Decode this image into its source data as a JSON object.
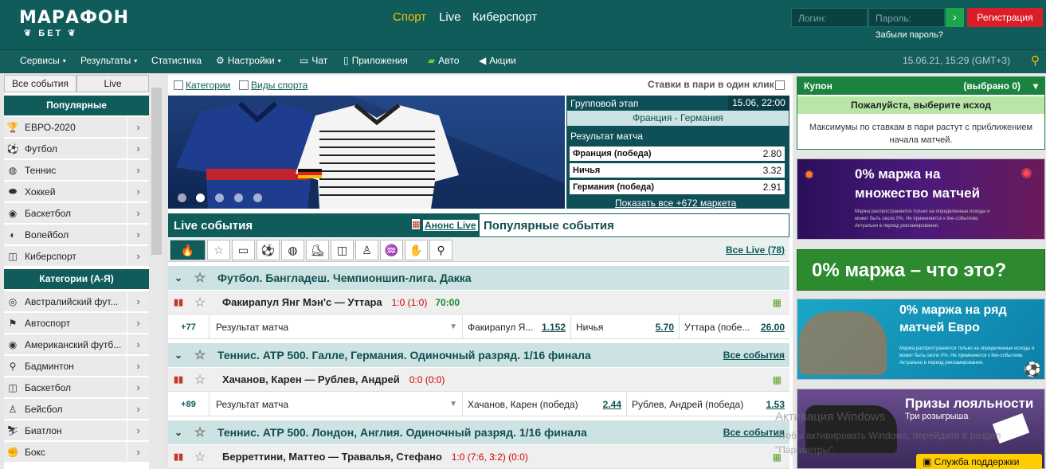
{
  "header": {
    "logo_main": "МАРАФОН",
    "logo_sub": "БЕТ",
    "nav": [
      "Спорт",
      "Live",
      "Киберспорт"
    ],
    "login_placeholder": "Логин:",
    "password_placeholder": "Пароль:",
    "register_label": "Регистрация",
    "forgot_label": "Забыли пароль?",
    "accent_color": "#f5c000"
  },
  "subnav": {
    "items": [
      "Сервисы",
      "Результаты",
      "Статистика",
      "Настройки",
      "Чат",
      "Приложения",
      "Авто",
      "Акции"
    ],
    "datetime": "15.06.21, 15:29 (GMT+3)"
  },
  "sidebar": {
    "tabs": [
      "Все события",
      "Live"
    ],
    "popular_title": "Популярные",
    "popular": [
      "ЕВРО-2020",
      "Футбол",
      "Теннис",
      "Хоккей",
      "Баскетбол",
      "Волейбол",
      "Киберспорт"
    ],
    "categories_title": "Категории (А-Я)",
    "categories": [
      "Австралийский фут...",
      "Автоспорт",
      "Американский футб...",
      "Бадминтон",
      "Баскетбол",
      "Бейсбол",
      "Биатлон",
      "Бокс"
    ]
  },
  "main": {
    "filter_categories": "Категории",
    "filter_sports": "Виды спорта",
    "one_click": "Ставки в пари в один клик",
    "banner": {
      "stage": "Групповой этап",
      "datetime": "15.06, 22:00",
      "match": "Франция - Германия",
      "market": "Результат матча",
      "odds": [
        {
          "label": "Франция (победа)",
          "value": "2.80"
        },
        {
          "label": "Ничья",
          "value": "3.32"
        },
        {
          "label": "Германия (победа)",
          "value": "2.91"
        }
      ],
      "more": "Показать все +672 маркета",
      "active_slide": 2
    },
    "tabs": {
      "live": "Live события",
      "announce": "Анонс Live",
      "popular": "Популярные события"
    },
    "all_live": "Все Live (78)",
    "leagues": [
      {
        "name": "Футбол. Бангладеш. Чемпионшип-лига. Дакка",
        "all": "",
        "event": {
          "teams": "Факирапул Янг Мэн'с — Уттара",
          "score": "1:0 (1:0)",
          "time": "70:00"
        },
        "market": {
          "count": "+77",
          "type": "Результат матча",
          "odds": [
            [
              "Факирапул Я...",
              "1.152"
            ],
            [
              "Ничья",
              "5.70"
            ],
            [
              "Уттара (побе...",
              "26.00"
            ]
          ]
        }
      },
      {
        "name": "Теннис. ATP 500. Галле, Германия. Одиночный разряд. 1/16 финала",
        "all": "Все события",
        "event": {
          "teams": "Хачанов, Карен — Рублев, Андрей",
          "score": "0:0 (0:0)",
          "time": ""
        },
        "market": {
          "count": "+89",
          "type": "Результат матча",
          "odds": [
            [
              "Хачанов, Карен (победа)",
              "2.44"
            ],
            [
              "Рублев, Андрей (победа)",
              "1.53"
            ]
          ]
        }
      },
      {
        "name": "Теннис. ATP 500. Лондон, Англия. Одиночный разряд. 1/16 финала",
        "all": "Все события",
        "event": {
          "teams": "Берреттини, Маттео — Травалья, Стефано",
          "score": "1:0 (7:6, 3:2) (0:0)",
          "time": ""
        }
      }
    ]
  },
  "coupon": {
    "title": "Купон",
    "selected": "(выбрано 0)",
    "message": "Пожалуйста, выберите исход",
    "note": "Максимумы по ставкам в пари растут с приближением начала матчей."
  },
  "promos": [
    {
      "title": "0% маржа на множество матчей",
      "sub": "Маржа распространяется только на определенные исходы и может быть около 0%. Не применяется к live-событиям. Актуально в период рекламирования."
    },
    {
      "title": "0% маржа – что это?"
    },
    {
      "title": "0% маржа на ряд матчей Евро",
      "sub": "Маржа распространяется только на определенные исходы и может быть около 0%. Не применяется к live-событиям. Актуально в период рекламирования."
    },
    {
      "title": "Призы лояльности",
      "sub": "Три розыгрыша"
    }
  ],
  "support": "Служба поддержки",
  "watermark": {
    "line1": "Активация Windows",
    "line2": "Чтобы активировать Windows, перейдите в раздел \"Параметры\"."
  }
}
